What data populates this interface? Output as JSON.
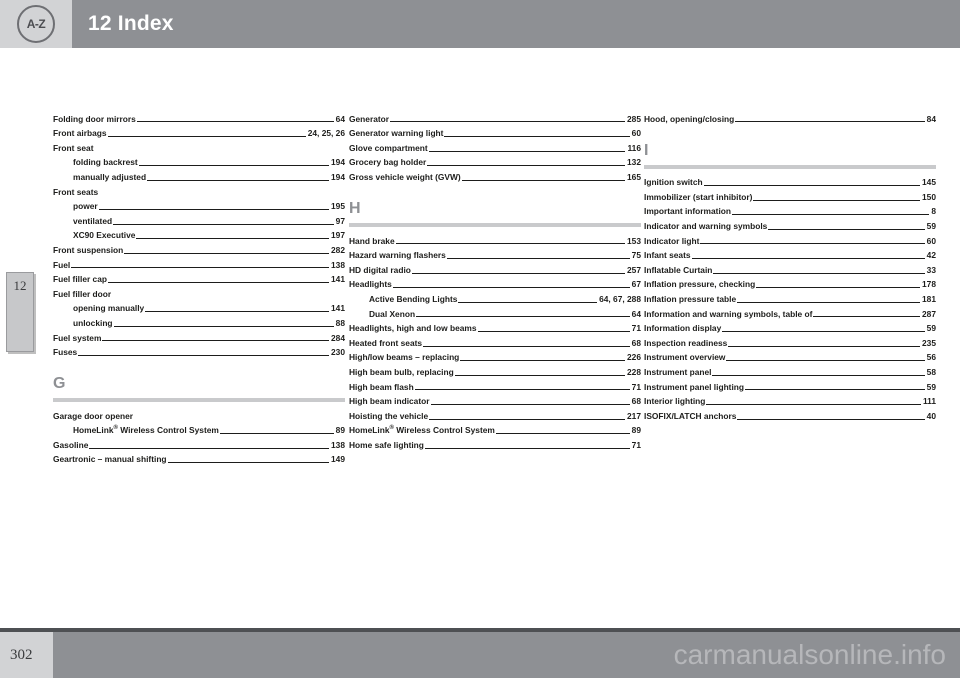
{
  "header": {
    "chapter_number": "12",
    "title": "12 Index",
    "badge_icon": "a-z-icon",
    "badge_label": "A-Z"
  },
  "side_tab": {
    "chapter": "12"
  },
  "footer": {
    "page_number": "302",
    "watermark": "carmanualsonline.info"
  },
  "columns": [
    {
      "id": "column-1",
      "blocks": [
        {
          "type": "entries",
          "entries": [
            {
              "text": "Folding door mirrors",
              "page": "64"
            },
            {
              "text": "Front airbags",
              "page": "24, 25, 26"
            },
            {
              "text": "Front seat",
              "page": ""
            },
            {
              "text": "folding backrest",
              "page": "194",
              "sub": true
            },
            {
              "text": "manually adjusted",
              "page": "194",
              "sub": true
            },
            {
              "text": "Front seats",
              "page": ""
            },
            {
              "text": "power",
              "page": "195",
              "sub": true
            },
            {
              "text": "ventilated",
              "page": "97",
              "sub": true
            },
            {
              "text": "XC90 Executive",
              "page": "197",
              "sub": true
            },
            {
              "text": "Front suspension",
              "page": "282"
            },
            {
              "text": "Fuel",
              "page": "138"
            },
            {
              "text": "Fuel filler cap",
              "page": "141"
            },
            {
              "text": "Fuel filler door",
              "page": ""
            },
            {
              "text": "opening manually",
              "page": "141",
              "sub": true
            },
            {
              "text": "unlocking",
              "page": "88",
              "sub": true
            },
            {
              "text": "Fuel system",
              "page": "284"
            },
            {
              "text": "Fuses",
              "page": "230"
            }
          ]
        },
        {
          "type": "section",
          "letter": "G",
          "entries": [
            {
              "text": "Garage door opener",
              "page": ""
            },
            {
              "text": "HomeLink® Wireless Control System",
              "page": "89",
              "sub": true
            },
            {
              "text": "Gasoline",
              "page": "138"
            },
            {
              "text": "Geartronic – manual shifting",
              "page": "149"
            }
          ]
        }
      ]
    },
    {
      "id": "column-2",
      "blocks": [
        {
          "type": "entries",
          "entries": [
            {
              "text": "Generator",
              "page": "285"
            },
            {
              "text": "Generator warning light",
              "page": "60"
            },
            {
              "text": "Glove compartment",
              "page": "116"
            },
            {
              "text": "Grocery bag holder",
              "page": "132"
            },
            {
              "text": "Gross vehicle weight (GVW)",
              "page": "165"
            }
          ]
        },
        {
          "type": "section",
          "letter": "H",
          "entries": [
            {
              "text": "Hand brake",
              "page": "153"
            },
            {
              "text": "Hazard warning flashers",
              "page": "75"
            },
            {
              "text": "HD digital radio",
              "page": "257"
            },
            {
              "text": "Headlights",
              "page": "67"
            },
            {
              "text": "Active Bending Lights",
              "page": "64, 67, 288",
              "sub": true
            },
            {
              "text": "Dual Xenon",
              "page": "64",
              "sub": true
            },
            {
              "text": "Headlights, high and low beams",
              "page": "71"
            },
            {
              "text": "Heated front seats",
              "page": "68"
            },
            {
              "text": "High/low beams – replacing",
              "page": "226"
            },
            {
              "text": "High beam bulb, replacing",
              "page": "228"
            },
            {
              "text": "High beam flash",
              "page": "71"
            },
            {
              "text": "High beam indicator",
              "page": "68"
            },
            {
              "text": "Hoisting the vehicle",
              "page": "217"
            },
            {
              "text": "HomeLink® Wireless Control System",
              "page": "89"
            },
            {
              "text": "Home safe lighting",
              "page": "71"
            }
          ]
        }
      ]
    },
    {
      "id": "column-3",
      "blocks": [
        {
          "type": "entries",
          "entries": [
            {
              "text": "Hood, opening/closing",
              "page": "84"
            }
          ]
        },
        {
          "type": "section",
          "letter": "I",
          "entries": [
            {
              "text": "Ignition switch",
              "page": "145"
            },
            {
              "text": "Immobilizer (start inhibitor)",
              "page": "150"
            },
            {
              "text": "Important information",
              "page": "8"
            },
            {
              "text": "Indicator and warning symbols",
              "page": "59"
            },
            {
              "text": "Indicator light",
              "page": "60"
            },
            {
              "text": "Infant seats",
              "page": "42"
            },
            {
              "text": "Inflatable Curtain",
              "page": "33"
            },
            {
              "text": "Inflation pressure, checking",
              "page": "178"
            },
            {
              "text": "Inflation pressure table",
              "page": "181"
            },
            {
              "text": "Information and warning symbols, table of",
              "page": "287",
              "wrap": true
            },
            {
              "text": "Information display",
              "page": "59"
            },
            {
              "text": "Inspection readiness",
              "page": "235"
            },
            {
              "text": "Instrument overview",
              "page": "56"
            },
            {
              "text": "Instrument panel",
              "page": "58"
            },
            {
              "text": "Instrument panel lighting",
              "page": "59"
            },
            {
              "text": "Interior lighting",
              "page": "111"
            },
            {
              "text": "ISOFIX/LATCH anchors",
              "page": "40"
            }
          ]
        }
      ]
    }
  ]
}
